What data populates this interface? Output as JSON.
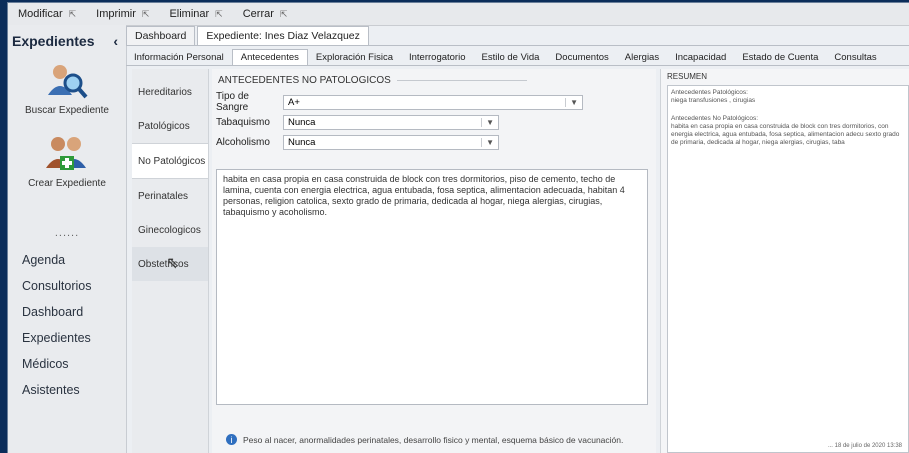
{
  "toolbar": {
    "items": [
      "Modificar",
      "Imprimir",
      "Eliminar",
      "Cerrar"
    ]
  },
  "leftnav": {
    "title": "Expedientes",
    "actions": [
      {
        "label": "Buscar Expediente",
        "icon": "search-user-icon"
      },
      {
        "label": "Crear Expediente",
        "icon": "add-user-icon"
      }
    ],
    "dots": "......",
    "menu": [
      "Agenda",
      "Consultorios",
      "Dashboard",
      "Expedientes",
      "Médicos",
      "Asistentes"
    ]
  },
  "tabs": {
    "main": [
      "Dashboard",
      "Expediente: Ines Diaz Velazquez"
    ],
    "sub": [
      "Información Personal",
      "Antecedentes",
      "Exploración Fisica",
      "Interrogatorio",
      "Estilo de Vida",
      "Documentos",
      "Alergias",
      "Incapacidad",
      "Estado de Cuenta",
      "Consultas"
    ]
  },
  "vtabs": [
    "Hereditarios",
    "Patológicos",
    "No Patológicos",
    "Perinatales",
    "Ginecologicos",
    "Obstetricos"
  ],
  "form": {
    "group_title": "ANTECEDENTES NO PATOLOGICOS",
    "fields": [
      {
        "label": "Tipo de Sangre",
        "value": "A+"
      },
      {
        "label": "Tabaquismo",
        "value": "Nunca"
      },
      {
        "label": "Alcoholismo",
        "value": "Nunca"
      }
    ],
    "notes": "habita en casa propia en casa construida de block con tres dormitorios, piso de cemento, techo de lamina, cuenta con energia electrica, agua entubada, fosa septica, alimentacion adecuada, habitan 4 personas, religion catolica, sexto grado de primaria, dedicada al hogar, niega alergias, cirugias, tabaquismo y acoholismo.",
    "hint": "Peso al nacer, anormalidades perinatales, desarrollo fisico y mental, esquema básico de vacunación."
  },
  "summary": {
    "title": "RESUMEN",
    "pat_title": "Antecedentes Patológicos:",
    "pat_text": "niega transfusiones , cirugias",
    "nopat_title": "Antecedentes No Patológicos:",
    "nopat_text": "habita en casa propia en casa construida de block con tres dormitorios, con energia electrica, agua entubada, fosa septica, alimentacion adecu sexto grado de primaria, dedicada al hogar, niega alergias, cirugias, taba",
    "footer": "... 18 de julio de 2020  13:38"
  }
}
